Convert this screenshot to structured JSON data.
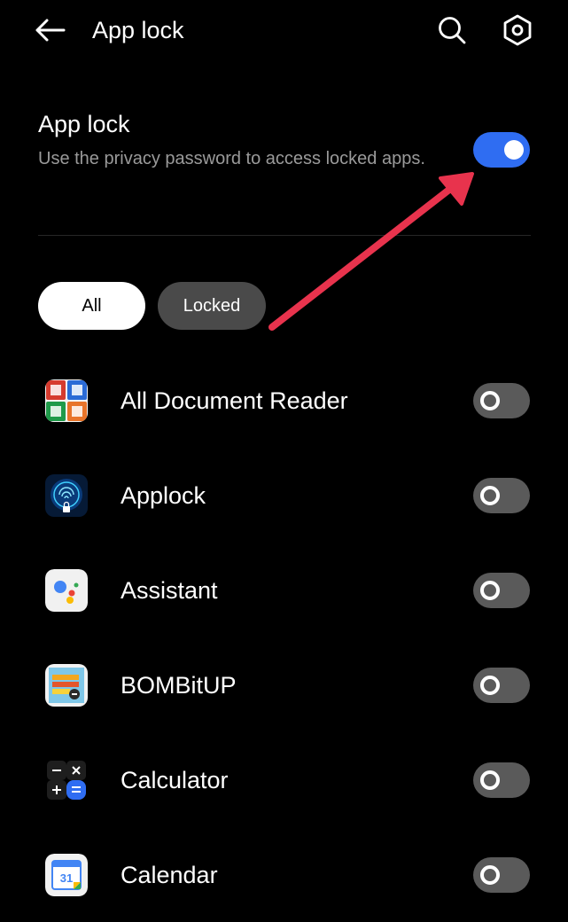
{
  "header": {
    "title": "App lock",
    "back_icon": "arrow-left-icon",
    "search_icon": "search-icon",
    "settings_icon": "hexagon-gear-icon"
  },
  "master": {
    "title": "App lock",
    "description": "Use the privacy password to access locked apps.",
    "enabled": true
  },
  "filters": {
    "all_label": "All",
    "locked_label": "Locked",
    "selected": "All"
  },
  "apps": [
    {
      "name": "All Document Reader",
      "icon": "document-reader-icon",
      "locked": false
    },
    {
      "name": "Applock",
      "icon": "fingerprint-lock-icon",
      "locked": false
    },
    {
      "name": "Assistant",
      "icon": "google-assistant-icon",
      "locked": false
    },
    {
      "name": "BOMBitUP",
      "icon": "bombitup-icon",
      "locked": false
    },
    {
      "name": "Calculator",
      "icon": "calculator-icon",
      "locked": false
    },
    {
      "name": "Calendar",
      "icon": "calendar-icon",
      "locked": false
    }
  ],
  "calendar_day": "31",
  "colors": {
    "background": "#000000",
    "toggle_on": "#2f6df2",
    "toggle_off": "#5a5a5a",
    "annotation_arrow": "#e8334d"
  }
}
